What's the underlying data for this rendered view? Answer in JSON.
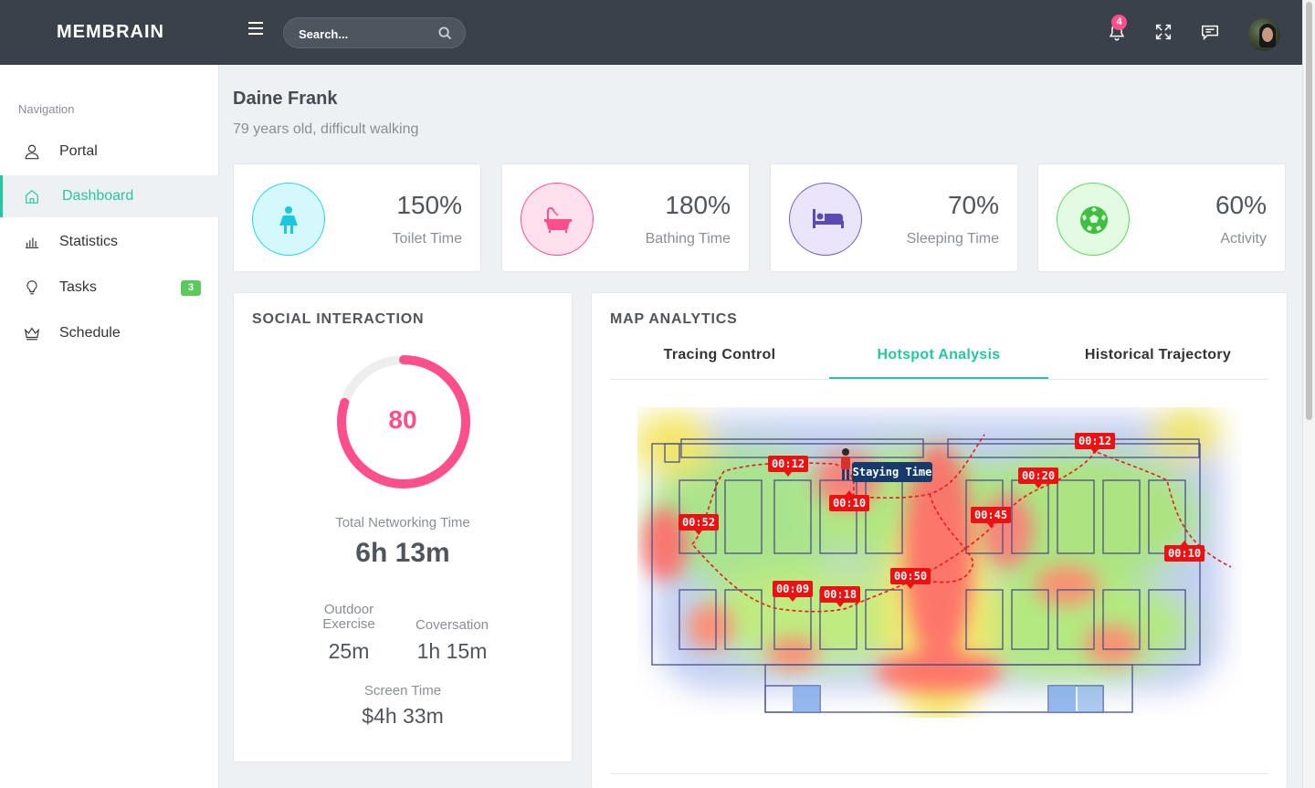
{
  "app": {
    "brand": "MEMBRAIN"
  },
  "header": {
    "search_placeholder": "Search...",
    "notification_count": "4"
  },
  "sidebar": {
    "title": "Navigation",
    "items": [
      {
        "label": "Portal",
        "icon": "user-icon"
      },
      {
        "label": "Dashboard",
        "icon": "home-icon",
        "active": true
      },
      {
        "label": "Statistics",
        "icon": "bar-chart-icon"
      },
      {
        "label": "Tasks",
        "icon": "lightbulb-icon",
        "badge": "3"
      },
      {
        "label": "Schedule",
        "icon": "crown-icon"
      }
    ]
  },
  "patient": {
    "name": "Daine Frank",
    "description": "79 years old, difficult walking"
  },
  "stats": [
    {
      "value": "150%",
      "label": "Toilet Time",
      "icon": "person-icon",
      "color": "#26d5e8"
    },
    {
      "value": "180%",
      "label": "Bathing Time",
      "icon": "bathtub-icon",
      "color": "#ff4f8b"
    },
    {
      "value": "70%",
      "label": "Sleeping Time",
      "icon": "bed-icon",
      "color": "#7560c9"
    },
    {
      "value": "60%",
      "label": "Activity",
      "icon": "soccer-ball-icon",
      "color": "#5cd85c"
    }
  ],
  "social": {
    "title": "SOCIAL INTERACTION",
    "score": "80",
    "score_fraction": 0.8,
    "total_label": "Total Networking Time",
    "total_value": "6h 13m",
    "outdoor_label_line1": "Outdoor",
    "outdoor_label_line2": "Exercise",
    "outdoor_value": "25m",
    "conversation_label": "Coversation",
    "conversation_value": "1h 15m",
    "screen_label": "Screen Time",
    "screen_value": "$4h 33m",
    "accent": "#ff4f8b"
  },
  "map": {
    "title": "MAP ANALYTICS",
    "tabs": [
      "Tracing Control",
      "Hotspot Analysis",
      "Historical Trajectory"
    ],
    "active_tab": 1,
    "staying_label": "Staying Time",
    "time_labels": [
      "00:12",
      "00:10",
      "00:52",
      "00:09",
      "00:18",
      "00:50",
      "00:45",
      "00:20",
      "00:12",
      "00:10"
    ]
  },
  "colors": {
    "accent": "#26c6a2",
    "topbar": "#39414a"
  }
}
